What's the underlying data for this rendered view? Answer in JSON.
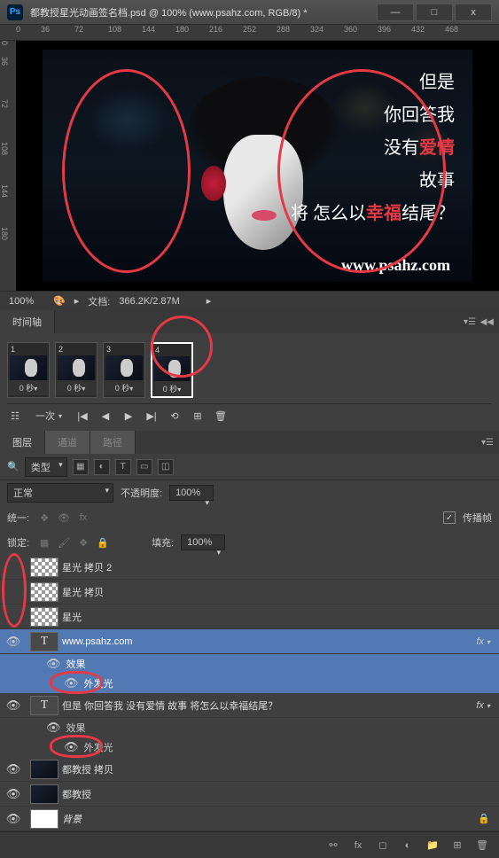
{
  "titlebar": {
    "filename": "都教授星光动画签名档.psd @ 100% (www.psahz.com, RGB/8) *"
  },
  "ruler_top": [
    "0",
    "36",
    "72",
    "108",
    "144",
    "180",
    "216",
    "252",
    "288",
    "324",
    "360",
    "396",
    "432",
    "468"
  ],
  "ruler_left": [
    "0",
    "36",
    "72",
    "108",
    "144",
    "180"
  ],
  "canvas_text": {
    "line1": "但是",
    "line2": "你回答我",
    "line3a": "没有",
    "line3b": "爱情",
    "line4": "故事",
    "line5a": "将 怎么以",
    "line5b": "幸福",
    "line5c": "结尾？",
    "watermark": "www.psahz.com"
  },
  "status": {
    "zoom": "100%",
    "doc_label": "文档:",
    "doc_size": "366.2K/2.87M"
  },
  "timeline": {
    "tab": "时间轴",
    "frame_time": "0 秒",
    "loop": "一次"
  },
  "layers_panel": {
    "tabs": [
      "图层",
      "通道",
      "路径"
    ],
    "filter_label": "类型",
    "blend_mode": "正常",
    "opacity_label": "不透明度:",
    "opacity_value": "100%",
    "unify_label": "统一:",
    "propagate": "传播帧",
    "lock_label": "锁定:",
    "fill_label": "填充:",
    "fill_value": "100%"
  },
  "layers": [
    {
      "visible": false,
      "thumb": "checker",
      "name": "星光 拷贝 2"
    },
    {
      "visible": false,
      "thumb": "checker",
      "name": "星光 拷贝"
    },
    {
      "visible": false,
      "thumb": "checker",
      "name": "星光"
    },
    {
      "visible": true,
      "thumb": "T",
      "name": "www.psahz.com",
      "selected": true,
      "fx": true,
      "effects": [
        "效果",
        "外发光"
      ]
    },
    {
      "visible": true,
      "thumb": "T",
      "name": "但是 你回答我 没有爱情 故事 将怎么以幸福结尾？",
      "fx": true,
      "effects": [
        "效果",
        "外发光"
      ]
    },
    {
      "visible": true,
      "thumb": "img",
      "name": "都教授 拷贝"
    },
    {
      "visible": true,
      "thumb": "img",
      "name": "都教授"
    },
    {
      "visible": true,
      "thumb": "white",
      "name": "背景",
      "italic": true
    }
  ],
  "sublayer_labels": {
    "effects": "效果",
    "outer_glow": "外发光"
  }
}
